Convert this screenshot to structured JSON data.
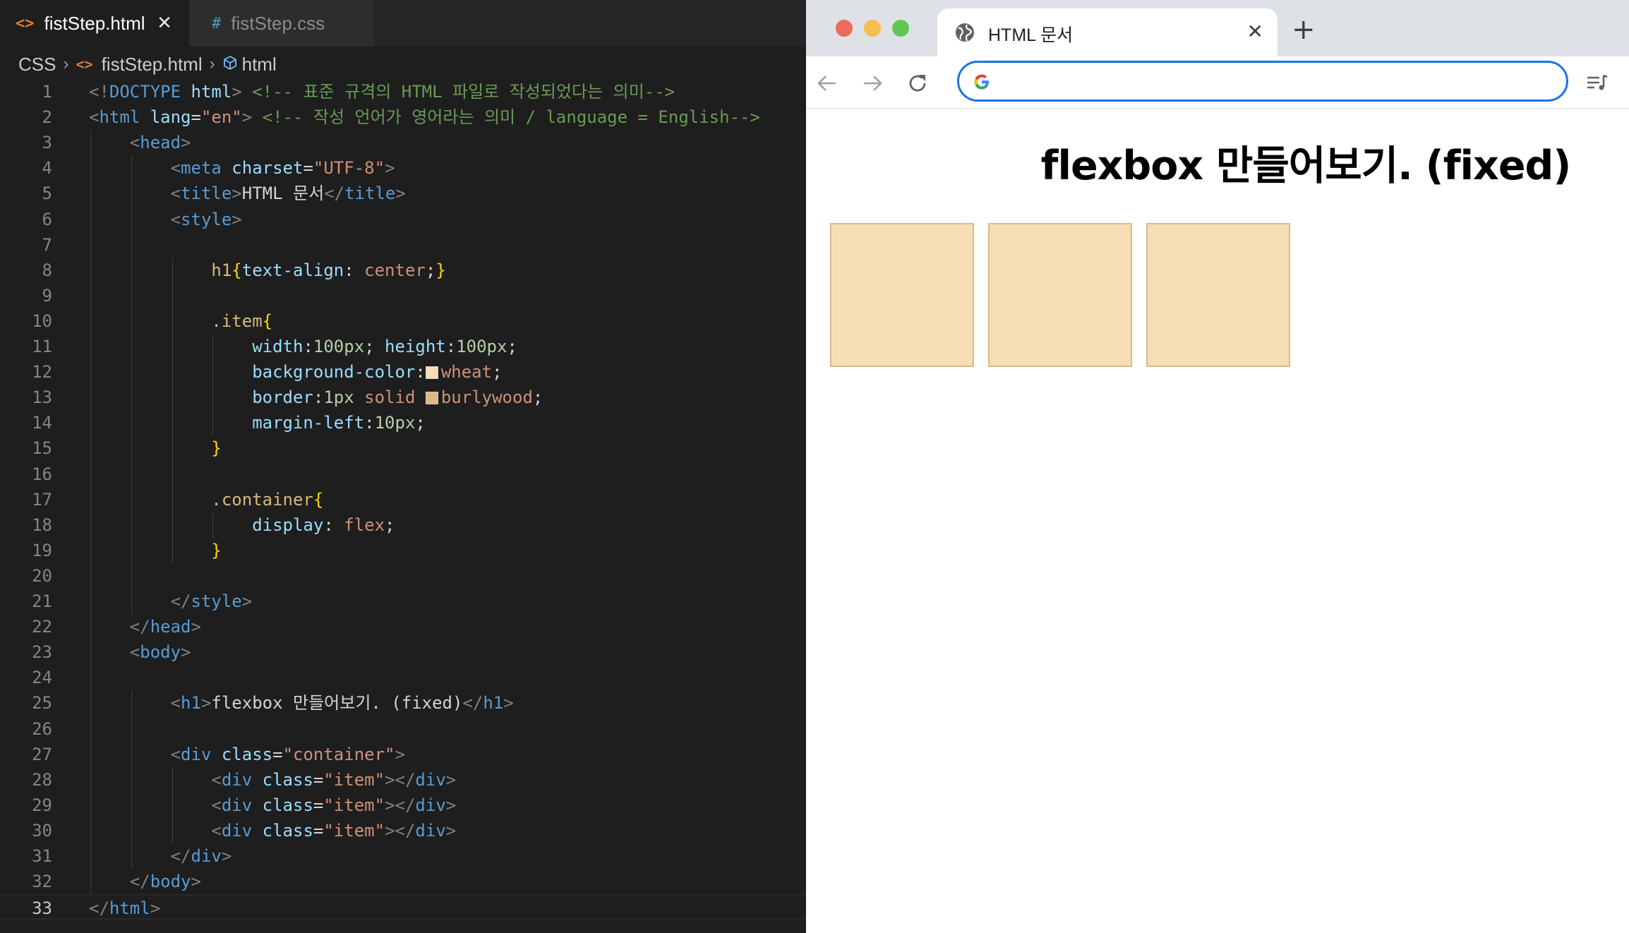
{
  "editor": {
    "tabs": [
      {
        "icon": "<>",
        "label": "fistStep.html",
        "active": true
      },
      {
        "icon": "#",
        "label": "fistStep.css",
        "active": false
      }
    ],
    "breadcrumb": [
      "CSS",
      "fistStep.html",
      "html"
    ],
    "current_line": 33,
    "lines": [
      {
        "n": 1,
        "indent": 0,
        "t": [
          [
            "br",
            "<!"
          ],
          [
            "tag",
            "DOCTYPE"
          ],
          [
            "txt",
            " "
          ],
          [
            "attr",
            "html"
          ],
          [
            "br",
            ">"
          ],
          [
            "txt",
            " "
          ],
          [
            "com",
            "<!-- 표준 규격의 HTML 파일로 작성되었다는 의미-->"
          ]
        ]
      },
      {
        "n": 2,
        "indent": 0,
        "t": [
          [
            "br",
            "<"
          ],
          [
            "tag",
            "html"
          ],
          [
            "txt",
            " "
          ],
          [
            "attr",
            "lang"
          ],
          [
            "txt",
            "="
          ],
          [
            "str",
            "\"en\""
          ],
          [
            "br",
            ">"
          ],
          [
            "txt",
            " "
          ],
          [
            "com",
            "<!-- 작성 언어가 영어라는 의미 / language = English-->"
          ]
        ]
      },
      {
        "n": 3,
        "indent": 1,
        "t": [
          [
            "br",
            "<"
          ],
          [
            "tag",
            "head"
          ],
          [
            "br",
            ">"
          ]
        ]
      },
      {
        "n": 4,
        "indent": 2,
        "t": [
          [
            "br",
            "<"
          ],
          [
            "tag",
            "meta"
          ],
          [
            "txt",
            " "
          ],
          [
            "attr",
            "charset"
          ],
          [
            "txt",
            "="
          ],
          [
            "str",
            "\"UTF-8\""
          ],
          [
            "br",
            ">"
          ]
        ]
      },
      {
        "n": 5,
        "indent": 2,
        "t": [
          [
            "br",
            "<"
          ],
          [
            "tag",
            "title"
          ],
          [
            "br",
            ">"
          ],
          [
            "txt",
            "HTML 문서"
          ],
          [
            "br",
            "</"
          ],
          [
            "tag",
            "title"
          ],
          [
            "br",
            ">"
          ]
        ]
      },
      {
        "n": 6,
        "indent": 2,
        "t": [
          [
            "br",
            "<"
          ],
          [
            "tag",
            "style"
          ],
          [
            "br",
            ">"
          ]
        ]
      },
      {
        "n": 7,
        "indent": 0,
        "t": []
      },
      {
        "n": 8,
        "indent": 3,
        "t": [
          [
            "sel",
            "h1"
          ],
          [
            "brace",
            "{"
          ],
          [
            "prop",
            "text-align"
          ],
          [
            "txt",
            ": "
          ],
          [
            "val",
            "center"
          ],
          [
            "txt",
            ";"
          ],
          [
            "brace",
            "}"
          ]
        ]
      },
      {
        "n": 9,
        "indent": 0,
        "t": []
      },
      {
        "n": 10,
        "indent": 3,
        "t": [
          [
            "sel",
            ".item"
          ],
          [
            "brace",
            "{"
          ]
        ]
      },
      {
        "n": 11,
        "indent": 4,
        "t": [
          [
            "prop",
            "width"
          ],
          [
            "txt",
            ":"
          ],
          [
            "num",
            "100px"
          ],
          [
            "txt",
            "; "
          ],
          [
            "prop",
            "height"
          ],
          [
            "txt",
            ":"
          ],
          [
            "num",
            "100px"
          ],
          [
            "txt",
            ";"
          ]
        ]
      },
      {
        "n": 12,
        "indent": 4,
        "t": [
          [
            "prop",
            "background-color"
          ],
          [
            "txt",
            ":"
          ],
          [
            "swatch",
            "#f5deb3"
          ],
          [
            "val",
            "wheat"
          ],
          [
            "txt",
            ";"
          ]
        ]
      },
      {
        "n": 13,
        "indent": 4,
        "t": [
          [
            "prop",
            "border"
          ],
          [
            "txt",
            ":"
          ],
          [
            "num",
            "1px"
          ],
          [
            "txt",
            " "
          ],
          [
            "val",
            "solid"
          ],
          [
            "txt",
            " "
          ],
          [
            "swatch",
            "#deb887"
          ],
          [
            "val",
            "burlywood"
          ],
          [
            "txt",
            ";"
          ]
        ]
      },
      {
        "n": 14,
        "indent": 4,
        "t": [
          [
            "prop",
            "margin-left"
          ],
          [
            "txt",
            ":"
          ],
          [
            "num",
            "10px"
          ],
          [
            "txt",
            ";"
          ]
        ]
      },
      {
        "n": 15,
        "indent": 3,
        "t": [
          [
            "brace",
            "}"
          ]
        ]
      },
      {
        "n": 16,
        "indent": 0,
        "t": []
      },
      {
        "n": 17,
        "indent": 3,
        "t": [
          [
            "sel",
            ".container"
          ],
          [
            "brace",
            "{"
          ]
        ]
      },
      {
        "n": 18,
        "indent": 4,
        "t": [
          [
            "prop",
            "display"
          ],
          [
            "txt",
            ": "
          ],
          [
            "val",
            "flex"
          ],
          [
            "txt",
            ";"
          ]
        ]
      },
      {
        "n": 19,
        "indent": 3,
        "t": [
          [
            "brace",
            "}"
          ]
        ]
      },
      {
        "n": 20,
        "indent": 0,
        "t": []
      },
      {
        "n": 21,
        "indent": 2,
        "t": [
          [
            "br",
            "</"
          ],
          [
            "tag",
            "style"
          ],
          [
            "br",
            ">"
          ]
        ]
      },
      {
        "n": 22,
        "indent": 1,
        "t": [
          [
            "br",
            "</"
          ],
          [
            "tag",
            "head"
          ],
          [
            "br",
            ">"
          ]
        ]
      },
      {
        "n": 23,
        "indent": 1,
        "t": [
          [
            "br",
            "<"
          ],
          [
            "tag",
            "body"
          ],
          [
            "br",
            ">"
          ]
        ]
      },
      {
        "n": 24,
        "indent": 0,
        "t": []
      },
      {
        "n": 25,
        "indent": 2,
        "t": [
          [
            "br",
            "<"
          ],
          [
            "tag",
            "h1"
          ],
          [
            "br",
            ">"
          ],
          [
            "txt",
            "flexbox 만들어보기. (fixed)"
          ],
          [
            "br",
            "</"
          ],
          [
            "tag",
            "h1"
          ],
          [
            "br",
            ">"
          ]
        ]
      },
      {
        "n": 26,
        "indent": 0,
        "t": []
      },
      {
        "n": 27,
        "indent": 2,
        "t": [
          [
            "br",
            "<"
          ],
          [
            "tag",
            "div"
          ],
          [
            "txt",
            " "
          ],
          [
            "attr",
            "class"
          ],
          [
            "txt",
            "="
          ],
          [
            "str",
            "\"container\""
          ],
          [
            "br",
            ">"
          ]
        ]
      },
      {
        "n": 28,
        "indent": 3,
        "t": [
          [
            "br",
            "<"
          ],
          [
            "tag",
            "div"
          ],
          [
            "txt",
            " "
          ],
          [
            "attr",
            "class"
          ],
          [
            "txt",
            "="
          ],
          [
            "str",
            "\"item\""
          ],
          [
            "br",
            "></"
          ],
          [
            "tag",
            "div"
          ],
          [
            "br",
            ">"
          ]
        ]
      },
      {
        "n": 29,
        "indent": 3,
        "t": [
          [
            "br",
            "<"
          ],
          [
            "tag",
            "div"
          ],
          [
            "txt",
            " "
          ],
          [
            "attr",
            "class"
          ],
          [
            "txt",
            "="
          ],
          [
            "str",
            "\"item\""
          ],
          [
            "br",
            "></"
          ],
          [
            "tag",
            "div"
          ],
          [
            "br",
            ">"
          ]
        ]
      },
      {
        "n": 30,
        "indent": 3,
        "t": [
          [
            "br",
            "<"
          ],
          [
            "tag",
            "div"
          ],
          [
            "txt",
            " "
          ],
          [
            "attr",
            "class"
          ],
          [
            "txt",
            "="
          ],
          [
            "str",
            "\"item\""
          ],
          [
            "br",
            "></"
          ],
          [
            "tag",
            "div"
          ],
          [
            "br",
            ">"
          ]
        ]
      },
      {
        "n": 31,
        "indent": 2,
        "t": [
          [
            "br",
            "</"
          ],
          [
            "tag",
            "div"
          ],
          [
            "br",
            ">"
          ]
        ]
      },
      {
        "n": 32,
        "indent": 1,
        "t": [
          [
            "br",
            "</"
          ],
          [
            "tag",
            "body"
          ],
          [
            "br",
            ">"
          ]
        ]
      },
      {
        "n": 33,
        "indent": 0,
        "t": [
          [
            "br",
            "</"
          ],
          [
            "tag",
            "html"
          ],
          [
            "br",
            ">"
          ]
        ]
      }
    ]
  },
  "browser": {
    "tab_title": "HTML 문서",
    "new_tab_label": "+",
    "close_label": "✕",
    "address_value": "",
    "page": {
      "heading": "flexbox 만들어보기. (fixed)",
      "items_count": 3,
      "item_background": "#f5deb3",
      "item_border": "#deb887"
    }
  },
  "colors": {
    "traffic_red": "#ed6a5e",
    "traffic_yellow": "#f5bf4f",
    "traffic_green": "#61c554",
    "omnibox_focus": "#1a73e8"
  }
}
